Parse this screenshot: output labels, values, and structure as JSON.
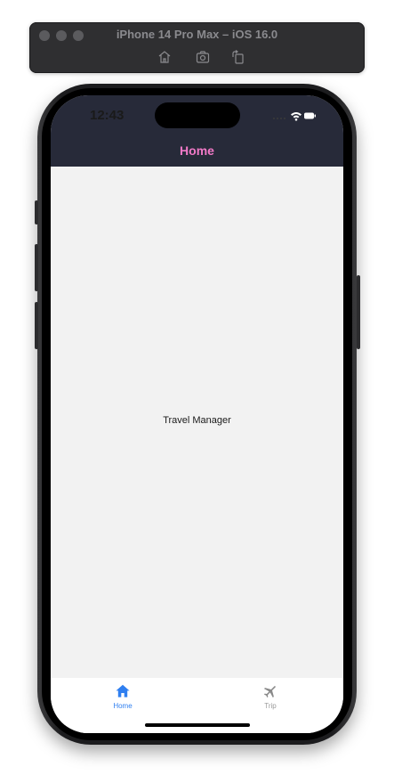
{
  "simulator": {
    "title": "iPhone 14 Pro Max – iOS 16.0",
    "tools": [
      "home-icon",
      "screenshot-icon",
      "rotate-icon"
    ]
  },
  "status_bar": {
    "time": "12:43",
    "icons": [
      "wifi-icon",
      "battery-icon"
    ]
  },
  "header": {
    "title": "Home",
    "background": "#272a39",
    "title_color": "#f27ac8"
  },
  "main": {
    "text": "Travel Manager",
    "background": "#f2f2f2"
  },
  "tab_bar": {
    "tabs": [
      {
        "label": "Home",
        "icon": "home-icon",
        "active": true,
        "color": "#2f7ff0"
      },
      {
        "label": "Trip",
        "icon": "airplane-icon",
        "active": false,
        "color": "#9a9a9a"
      }
    ]
  }
}
